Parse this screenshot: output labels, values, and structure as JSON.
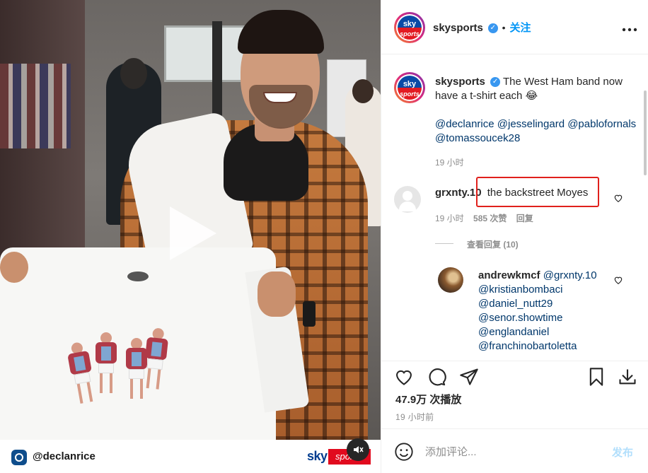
{
  "video": {
    "handle": "@declanrice",
    "brand_sky": "sky",
    "brand_sports": "sports",
    "mute_icon": "speaker-muted-icon",
    "play_icon": "play-icon"
  },
  "header": {
    "username": "skysports",
    "verified_icon": "verified-badge-icon",
    "separator": "•",
    "follow_label": "关注",
    "more_icon": "more-horizontal-icon",
    "avatar_top": "sky",
    "avatar_bottom": "sports"
  },
  "caption": {
    "username": "skysports",
    "text": "The West Ham band now have a t-shirt each 😂",
    "mentions": "@declanrice @jesselingard @pablofornals @tomassoucek28",
    "time": "19 小时"
  },
  "comment": {
    "username": "grxnty.10",
    "text": "the backstreet Moyes",
    "time": "19 小时",
    "likes": "585 次赞",
    "reply_label": "回复",
    "view_replies": "查看回复 (10)"
  },
  "reply": {
    "username": "andrewkmcf",
    "mention_to": "@grxnty.10",
    "mentions": [
      "@kristianbombaci",
      "@daniel_nutt29",
      "@senor.showtime",
      "@englandaniel",
      "@franchinobartoletta"
    ]
  },
  "actions": {
    "plays": "47.9万 次播放",
    "time": "19 小时前"
  },
  "input": {
    "placeholder": "添加评论...",
    "post_label": "发布"
  },
  "colors": {
    "link": "#00376b",
    "accent": "#0095f6",
    "highlight": "#e0201c",
    "muted": "#8e8e8e"
  }
}
